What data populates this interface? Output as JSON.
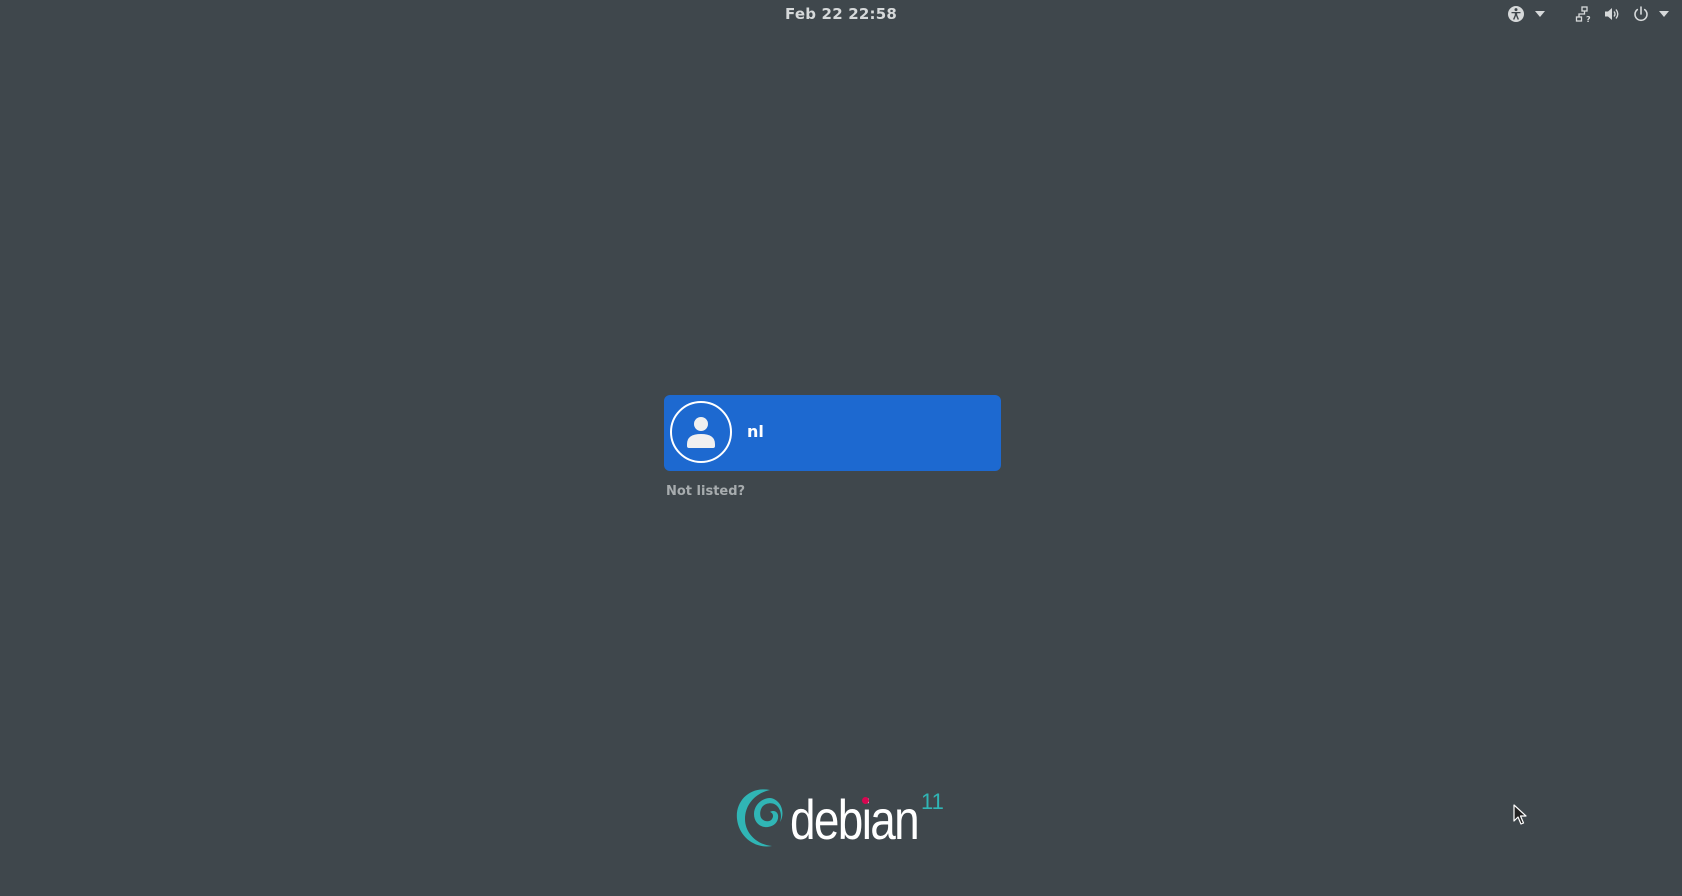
{
  "topbar": {
    "clock": "Feb 22  22:58",
    "tray_icons": [
      "accessibility-icon",
      "chevron-down-icon",
      "network-icon",
      "volume-icon",
      "power-icon",
      "chevron-down-icon"
    ]
  },
  "login": {
    "users": [
      {
        "name": "nl",
        "avatar": "user-icon"
      }
    ],
    "not_listed": "Not listed?"
  },
  "branding": {
    "logo_word": "debian",
    "version": "11",
    "colors": {
      "swirl": "#30b5b5",
      "dot": "#d70751"
    }
  },
  "colors": {
    "background": "#3f474c",
    "selected_user": "#1d69d0"
  }
}
